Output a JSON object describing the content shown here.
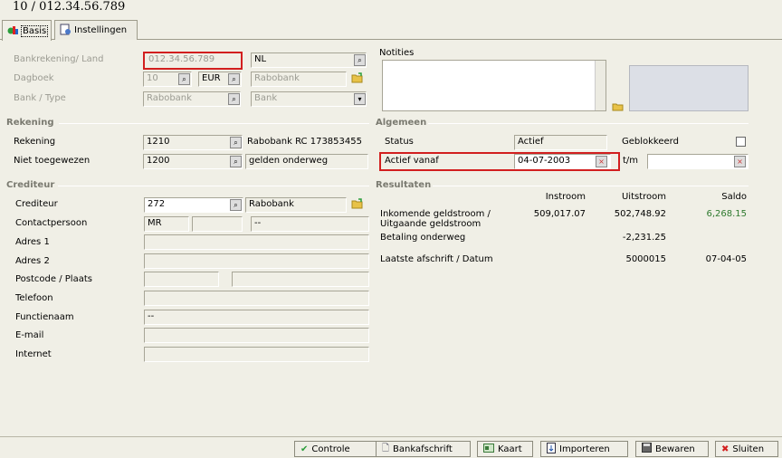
{
  "window": {
    "title": "10 / 012.34.56.789"
  },
  "tabs": [
    {
      "label": "Basis",
      "icon": "chart-pie-icon"
    },
    {
      "label": "Instellingen",
      "icon": "settings-document-icon"
    }
  ],
  "top": {
    "bankrekening_label": "Bankrekening/ Land",
    "bankrekening_value": "012.34.56.789",
    "land_value": "NL",
    "dagboek_label": "Dagboek",
    "dagboek_value": "10",
    "dagboek_currency": "EUR",
    "dagboek_name": "Rabobank",
    "bank_type_label": "Bank / Type",
    "bank_value": "Rabobank",
    "type_value": "Bank",
    "notities_label": "Notities"
  },
  "rekening": {
    "section_label": "Rekening",
    "rekening_label": "Rekening",
    "rekening_value": "1210",
    "rekening_desc": "Rabobank RC 173853455",
    "niet_toegewezen_label": "Niet toegewezen",
    "niet_toegewezen_value": "1200",
    "niet_toegewezen_desc": "gelden onderweg"
  },
  "algemeen": {
    "section_label": "Algemeen",
    "status_label": "Status",
    "status_value": "Actief",
    "geblokkeerd_label": "Geblokkeerd",
    "actief_vanaf_label": "Actief vanaf",
    "actief_vanaf_value": "04-07-2003",
    "tm_label": "t/m"
  },
  "crediteur": {
    "section_label": "Crediteur",
    "crediteur_label": "Crediteur",
    "crediteur_value": "272",
    "crediteur_name": "Rabobank",
    "contactpersoon_label": "Contactpersoon",
    "contact_title": "MR",
    "contact_name": "--",
    "adres1_label": "Adres 1",
    "adres2_label": "Adres 2",
    "postcode_label": "Postcode / Plaats",
    "telefoon_label": "Telefoon",
    "functienaam_label": "Functienaam",
    "functienaam_value": "--",
    "email_label": "E-mail",
    "internet_label": "Internet"
  },
  "resultaten": {
    "section_label": "Resultaten",
    "col_instroom": "Instroom",
    "col_uitstroom": "Uitstroom",
    "col_saldo": "Saldo",
    "row1_label_line1": "Inkomende geldstroom /",
    "row1_label_line2": "Uitgaande geldstroom",
    "row1_instroom": "509,017.07",
    "row1_uitstroom": "502,748.92",
    "row1_saldo": "6,268.15",
    "row2_label": "Betaling onderweg",
    "row2_uitstroom": "-2,231.25",
    "row3_label": "Laatste afschrift / Datum",
    "row3_uitstroom": "5000015",
    "row3_saldo": "07-04-05"
  },
  "buttons": {
    "controle": "Controle",
    "bankafschrift": "Bankafschrift",
    "kaart": "Kaart",
    "importeren": "Importeren",
    "bewaren": "Bewaren",
    "sluiten": "Sluiten"
  },
  "colors": {
    "accent_red": "#d21f1f",
    "saldo_green": "#2f7a2f"
  }
}
